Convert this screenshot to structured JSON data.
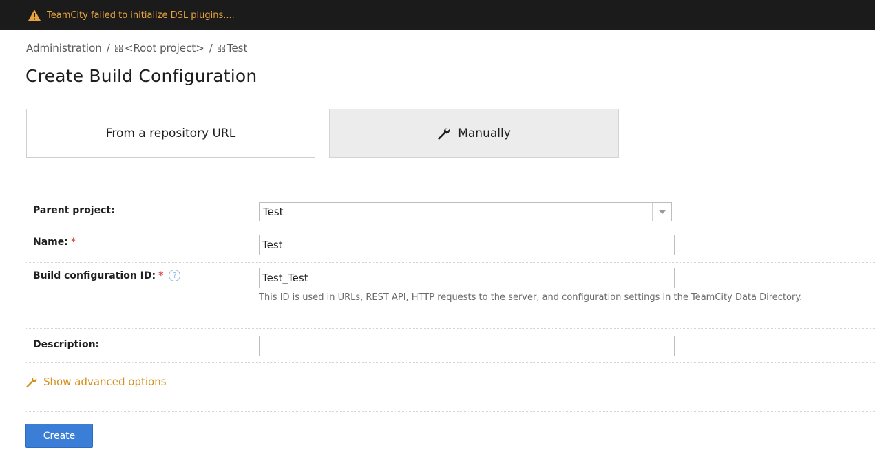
{
  "banner": {
    "text": "TeamCity failed to initialize DSL plugins....",
    "warning_icon": "warning-icon"
  },
  "breadcrumb": {
    "items": [
      "Administration",
      "<Root project>",
      "Test"
    ],
    "separator": "/"
  },
  "page": {
    "title": "Create Build Configuration"
  },
  "modes": {
    "repo_label": "From a repository URL",
    "manual_label": "Manually",
    "selected": "Manually"
  },
  "form": {
    "parent_label": "Parent project:",
    "parent_value": "Test",
    "name_label": "Name:",
    "name_value": "Test",
    "id_label": "Build configuration ID:",
    "id_value": "Test_Test",
    "id_hint": "This ID is used in URLs, REST API, HTTP requests to the server, and configuration settings in the TeamCity Data Directory.",
    "desc_label": "Description:",
    "desc_value": "",
    "required_mark": "*",
    "help_mark": "?"
  },
  "advanced": {
    "label": "Show advanced options"
  },
  "actions": {
    "create_label": "Create"
  },
  "colors": {
    "accent": "#3b7ed8",
    "warning": "#e8a33d",
    "link": "#d4901c",
    "required": "#d9534f"
  }
}
